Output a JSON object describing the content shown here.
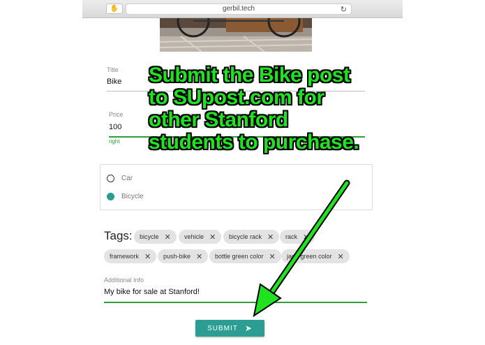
{
  "browser": {
    "url": "gerbil.tech",
    "tab_icon": "hand-icon",
    "reload_icon": "reload-icon"
  },
  "form": {
    "title": {
      "label": "Title",
      "value": "Bike"
    },
    "price": {
      "label": "Price",
      "value": "100",
      "helper": "right"
    },
    "category": {
      "options": [
        {
          "label": "Car",
          "selected": false
        },
        {
          "label": "Bicycle",
          "selected": true
        }
      ]
    },
    "tags": {
      "label": "Tags:",
      "items": [
        "bicycle",
        "vehicle",
        "bicycle rack",
        "rack",
        "framework",
        "push-bike",
        "bottle green color",
        "jade green color"
      ]
    },
    "additional": {
      "label": "Additional Info",
      "value": "My bike for sale at Stanford!"
    },
    "submit": {
      "label": "SUBMIT",
      "icon": "send-icon"
    }
  },
  "annotation": {
    "lines": [
      "Submit the Bike post",
      "to SUpost.com for",
      "other Stanford",
      "students to purchase."
    ],
    "color": "#21e221"
  },
  "colors": {
    "accent": "#2a9d8f",
    "underline_green": "#2e9e3a"
  }
}
